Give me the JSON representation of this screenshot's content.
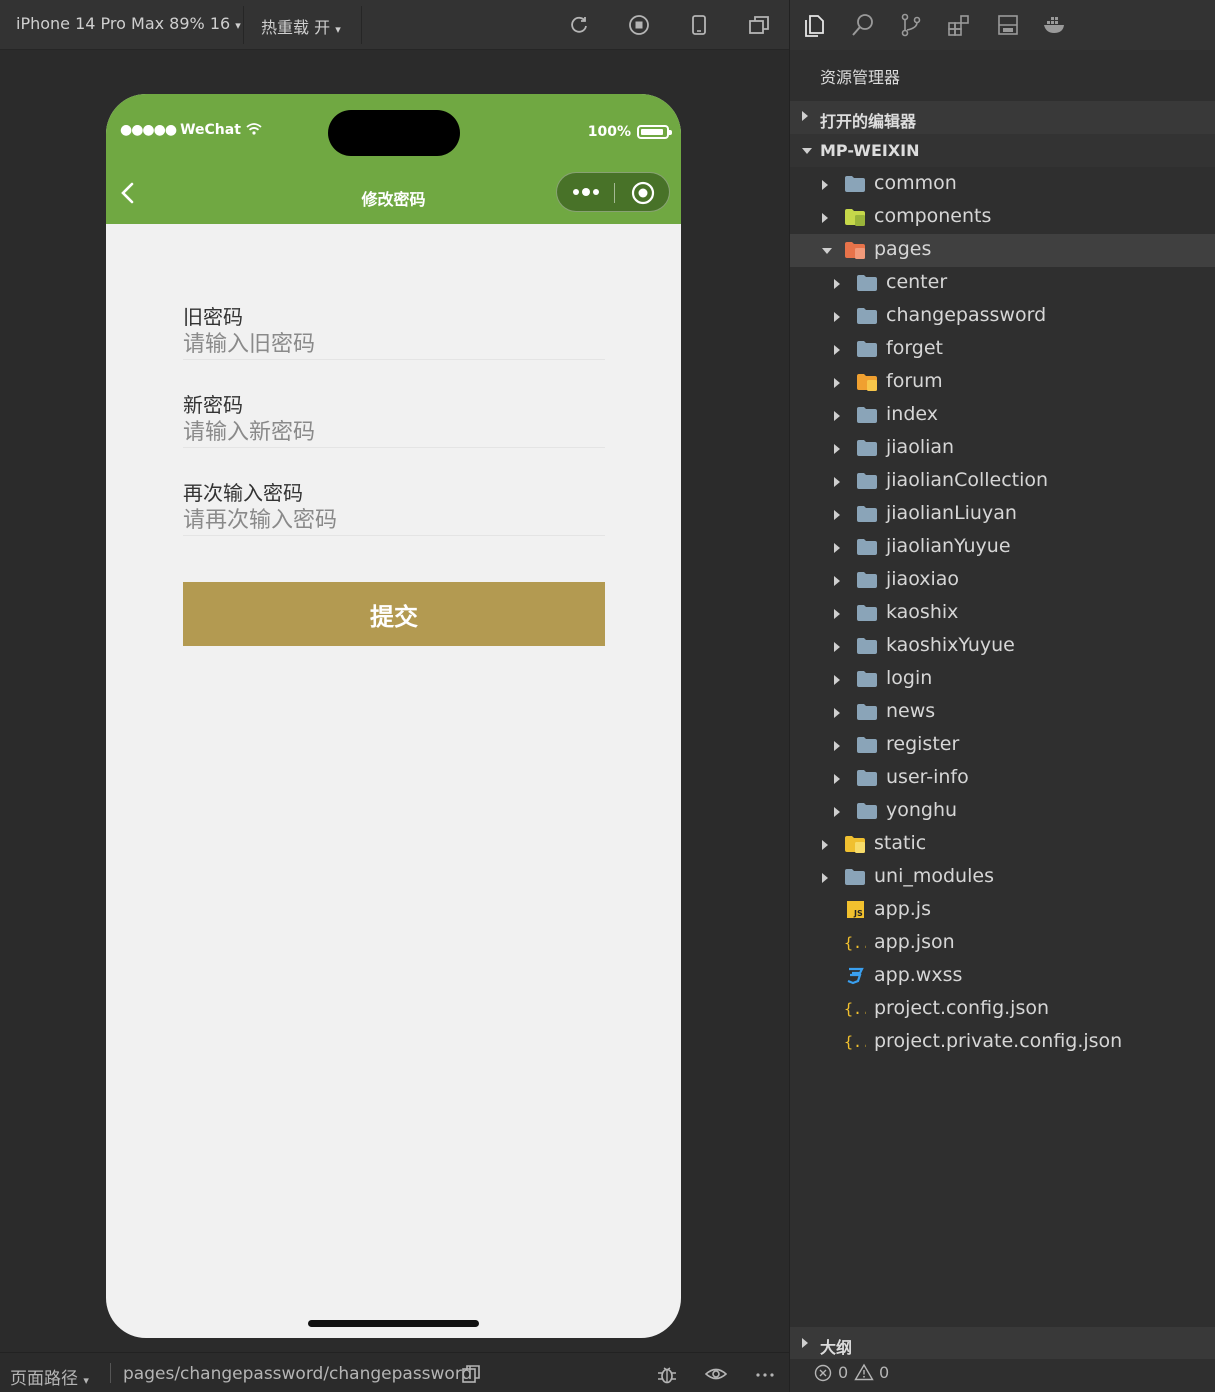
{
  "toolbar": {
    "device": "iPhone 14 Pro Max 89% 16",
    "hot_reload": "热重载 开"
  },
  "phone": {
    "status_bar": {
      "carrier": "WeChat",
      "battery": "100%"
    },
    "navbar": {
      "title": "修改密码"
    },
    "form": {
      "old_password": {
        "label": "旧密码",
        "placeholder": "请输入旧密码"
      },
      "new_password": {
        "label": "新密码",
        "placeholder": "请输入新密码"
      },
      "confirm_password": {
        "label": "再次输入密码",
        "placeholder": "请再次输入密码"
      },
      "submit_label": "提交"
    },
    "colors": {
      "navbar": "#70a842",
      "submit": "#b39a51",
      "background": "#f1f1f1"
    }
  },
  "bottom_bar": {
    "page_path_label": "页面路径",
    "page_path": "pages/changepassword/changepassword"
  },
  "explorer": {
    "title": "资源管理器",
    "open_editors": "打开的编辑器",
    "project": "MP-WEIXIN",
    "tree": {
      "common": "common",
      "components": "components",
      "pages": "pages",
      "pages_children": [
        "center",
        "changepassword",
        "forget",
        "forum",
        "index",
        "jiaolian",
        "jiaolianCollection",
        "jiaolianLiuyan",
        "jiaolianYuyue",
        "jiaoxiao",
        "kaoshix",
        "kaoshixYuyue",
        "login",
        "news",
        "register",
        "user-info",
        "yonghu"
      ],
      "static": "static",
      "uni_modules": "uni_modules",
      "files": [
        "app.js",
        "app.json",
        "app.wxss",
        "project.config.json",
        "project.private.config.json"
      ]
    },
    "outline": "大纲",
    "problems": {
      "errors": "0",
      "warnings": "0"
    }
  }
}
